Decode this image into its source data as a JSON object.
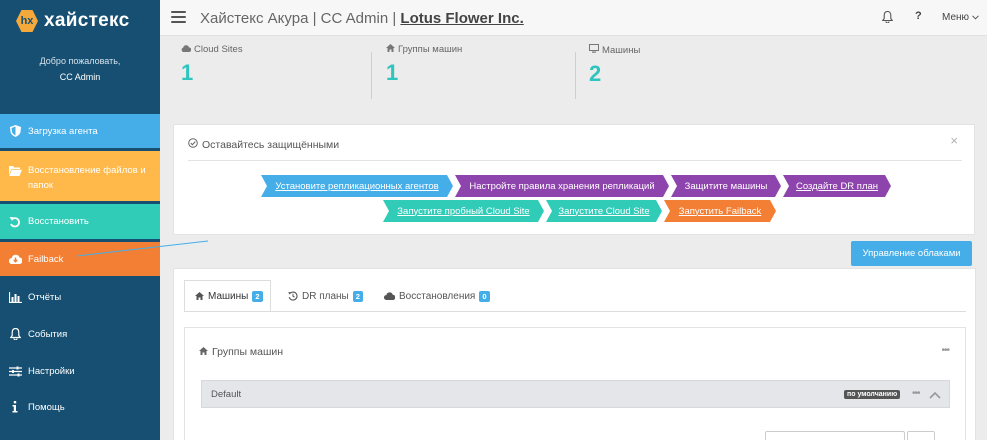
{
  "brand": {
    "badge": "hx",
    "name": "хайстекс"
  },
  "welcome": {
    "greeting": "Добро пожаловать,",
    "user": "CC Admin"
  },
  "sidebar": {
    "items": [
      {
        "label": "Загрузка агента",
        "icon": "shield-icon",
        "color": "#45aee9"
      },
      {
        "label": "Восстановление файлов и папок",
        "icon": "folder-open-icon",
        "color": "#ffb84a"
      },
      {
        "label": "Восстановить",
        "icon": "undo-icon",
        "color": "#31ccb8"
      },
      {
        "label": "Failback",
        "icon": "cloud-download-icon",
        "color": "#f27f34"
      },
      {
        "label": "Отчёты",
        "icon": "bar-chart-icon"
      },
      {
        "label": "События",
        "icon": "bell-icon"
      },
      {
        "label": "Настройки",
        "icon": "sliders-icon"
      },
      {
        "label": "Помощь",
        "icon": "info-icon"
      }
    ]
  },
  "header": {
    "title_prefix": "Хайстекс Акура | CC Admin | ",
    "org": "Lotus Flower Inc.",
    "help": "?",
    "menu_label": "Меню"
  },
  "stats": [
    {
      "label": "Cloud Sites",
      "value": "1",
      "icon": "cloud-icon"
    },
    {
      "label": "Группы машин",
      "value": "1",
      "icon": "home-icon"
    },
    {
      "label": "Машины",
      "value": "2",
      "icon": "monitor-icon"
    }
  ],
  "protect": {
    "title": "Оставайтесь защищёнными",
    "close": "×",
    "steps": [
      {
        "label": "Установите репликационных агентов",
        "color": "#45aee9"
      },
      {
        "label": "Настройте правила хранения репликаций",
        "color": "#8e44ad"
      },
      {
        "label": "Защитите машины",
        "color": "#8e44ad"
      },
      {
        "label": "Создайте DR план",
        "color": "#8e44ad"
      },
      {
        "label": "Запустите пробный Cloud Site",
        "color": "#31ccb8"
      },
      {
        "label": "Запустите Cloud Site",
        "color": "#31ccb8"
      },
      {
        "label": "Запустить Failback",
        "color": "#f27f34"
      }
    ]
  },
  "cloud_button": "Управление облаками",
  "tabs": [
    {
      "label": "Машины",
      "count": "2",
      "icon": "home-icon"
    },
    {
      "label": "DR планы",
      "count": "2",
      "icon": "history-icon"
    },
    {
      "label": "Восстановления",
      "count": "0",
      "icon": "cloud-icon"
    }
  ],
  "groups": {
    "title": "Группы машин",
    "dots": "•••",
    "default_row": {
      "label": "Default",
      "badge": "по умолчанию",
      "dots": "•••"
    }
  }
}
